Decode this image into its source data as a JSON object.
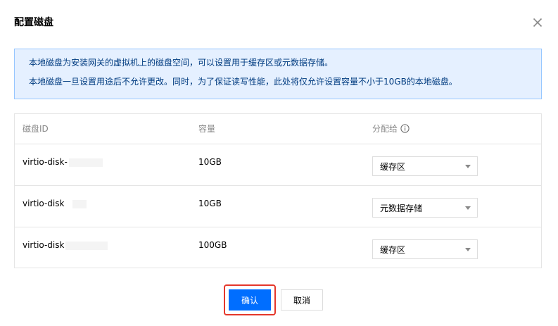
{
  "dialog": {
    "title": "配置磁盘",
    "close_icon": "close-icon"
  },
  "notice": {
    "line1": "本地磁盘为安装网关的虚拟机上的磁盘空间，可以设置用于缓存区或元数据存储。",
    "line2": "本地磁盘一旦设置用途后不允许更改。同时，为了保证读写性能，此处将仅允许设置容量不小于10GB的本地磁盘。"
  },
  "table": {
    "columns": {
      "id": "磁盘ID",
      "capacity": "容量",
      "assign": "分配给",
      "assign_icon": "info-icon"
    },
    "rows": [
      {
        "id": "virtio-disk-",
        "capacity": "10GB",
        "assign": "缓存区"
      },
      {
        "id": "virtio-disk",
        "capacity": "10GB",
        "assign": "元数据存储"
      },
      {
        "id": "virtio-disk",
        "capacity": "100GB",
        "assign": "缓存区"
      }
    ]
  },
  "footer": {
    "confirm_label": "确认",
    "cancel_label": "取消"
  },
  "colors": {
    "primary": "#006eff",
    "notice_bg": "#e5f0ff",
    "notice_border": "#97c7ff",
    "notice_text": "#003b80",
    "highlight": "#e5372b"
  }
}
